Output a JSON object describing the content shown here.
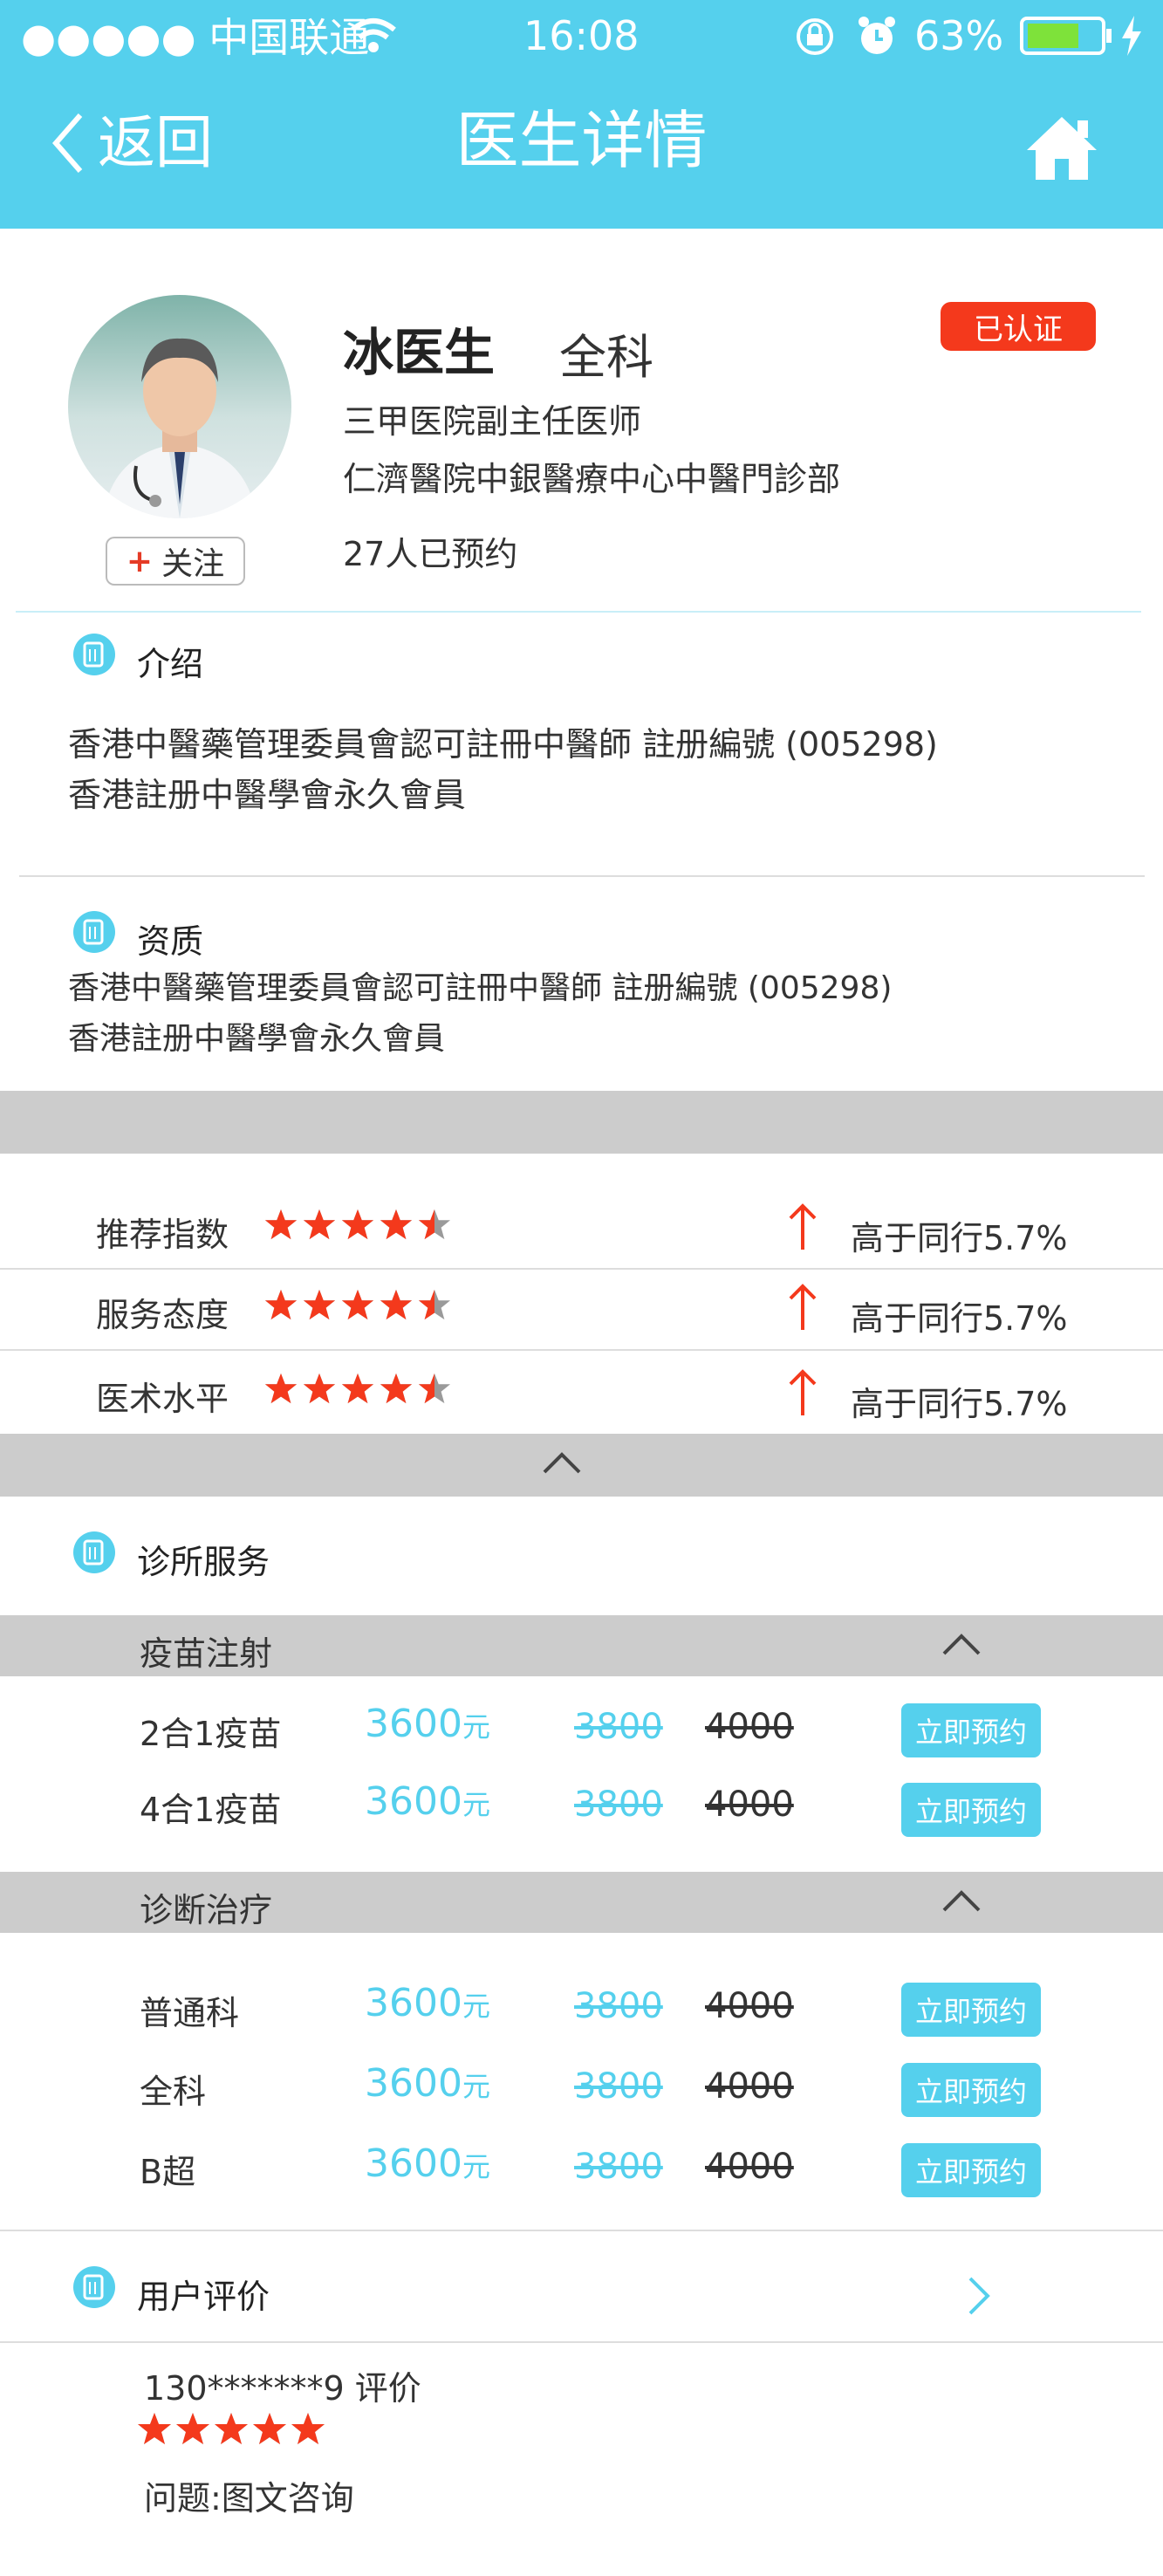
{
  "status_bar": {
    "carrier": "●●●●● 中国联通",
    "time": "16:08",
    "battery": "63%"
  },
  "nav": {
    "back_label": "返回",
    "title": "医生详情",
    "home_icon": "home-icon"
  },
  "doctor": {
    "name": "冰医生",
    "department": "全科",
    "certified_label": "已认证",
    "title": "三甲医院副主任医师",
    "hospital": "仁濟醫院中銀醫療中心中醫門診部",
    "booked": "27人已预约",
    "follow_label": "关注"
  },
  "intro": {
    "heading": "介绍",
    "lines": [
      "香港中醫藥管理委員會認可註冊中醫師 註册編號 (005298)",
      "香港註册中醫學會永久會員"
    ]
  },
  "qualification": {
    "heading": "资质",
    "lines": [
      "香港中醫藥管理委員會認可註冊中醫師 註册編號 (005298)",
      "香港註册中醫學會永久會員"
    ]
  },
  "ratings": [
    {
      "label": "推荐指数",
      "stars": 4.5,
      "compare": "高于同行5.7%"
    },
    {
      "label": "服务态度",
      "stars": 4.5,
      "compare": "高于同行5.7%"
    },
    {
      "label": "医术水平",
      "stars": 4.5,
      "compare": "高于同行5.7%"
    }
  ],
  "services": {
    "heading": "诊所服务",
    "categories": [
      {
        "label": "疫苗注射",
        "items": [
          {
            "name": "2合1疫苗",
            "price": "3600",
            "unit": "元",
            "old1": "3800",
            "old2": "4000",
            "button": "立即预约"
          },
          {
            "name": "4合1疫苗",
            "price": "3600",
            "unit": "元",
            "old1": "3800",
            "old2": "4000",
            "button": "立即预约"
          }
        ]
      },
      {
        "label": "诊断治疗",
        "items": [
          {
            "name": "普通科",
            "price": "3600",
            "unit": "元",
            "old1": "3800",
            "old2": "4000",
            "button": "立即预约"
          },
          {
            "name": "全科",
            "price": "3600",
            "unit": "元",
            "old1": "3800",
            "old2": "4000",
            "button": "立即预约"
          },
          {
            "name": "B超",
            "price": "3600",
            "unit": "元",
            "old1": "3800",
            "old2": "4000",
            "button": "立即预约"
          }
        ]
      }
    ]
  },
  "reviews": {
    "heading": "用户评价",
    "reviewer": "130*******9  评价",
    "stars": 5,
    "question": "问题:图文咨询"
  },
  "colors": {
    "brand": "#55d0ed",
    "star": "#f4391c",
    "badge": "#f4391c"
  }
}
